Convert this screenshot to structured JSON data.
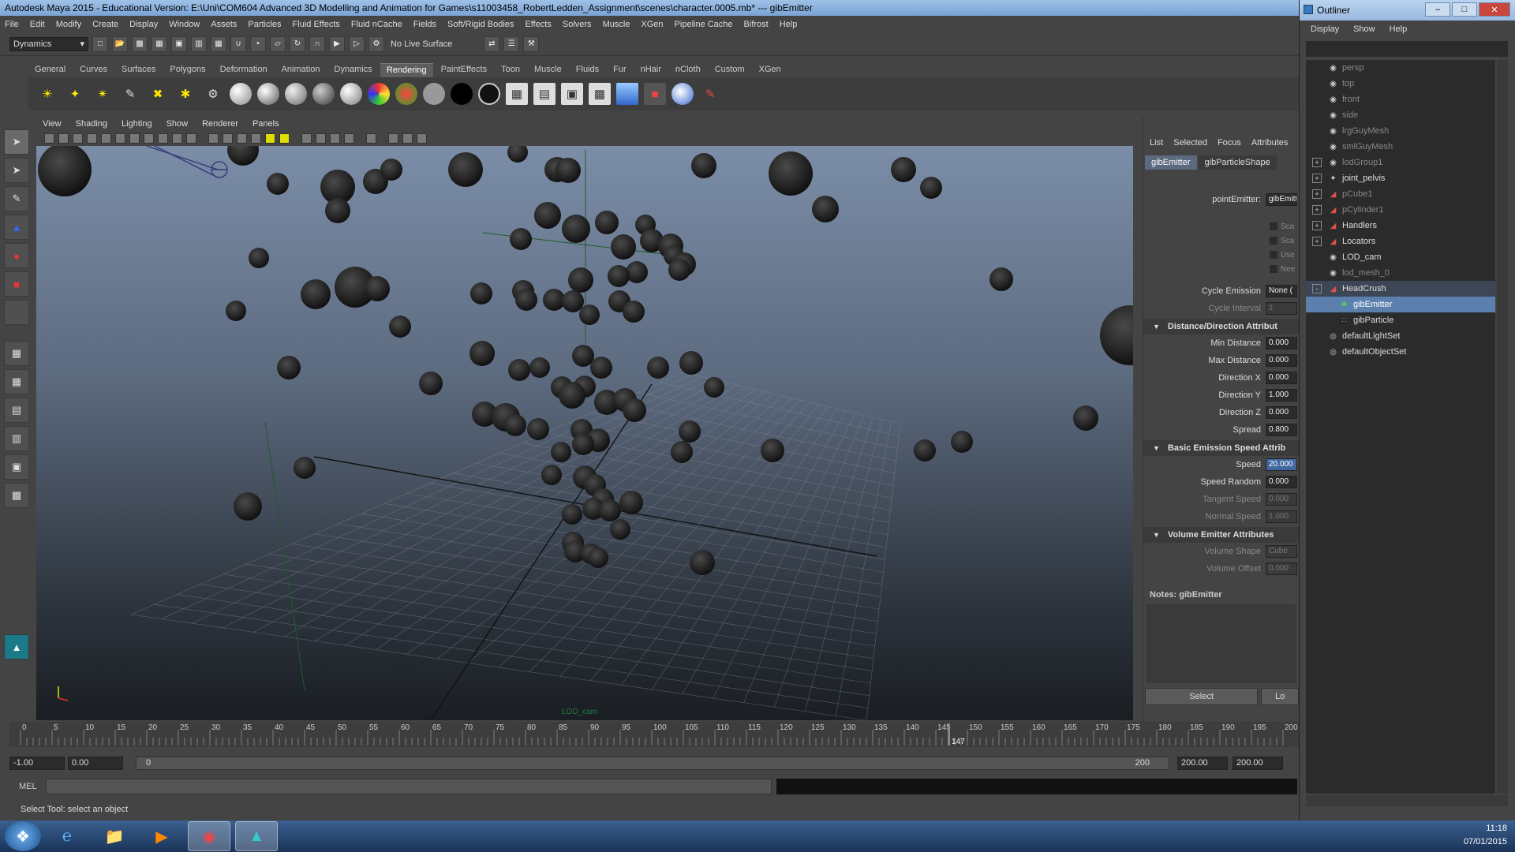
{
  "window": {
    "title": "Autodesk Maya 2015 - Educational Version: E:\\Uni\\COM604 Advanced 3D Modelling and Animation for Games\\s11003458_RobertLedden_Assignment\\scenes\\character.0005.mb*   ---   gibEmitter"
  },
  "menus": [
    "File",
    "Edit",
    "Modify",
    "Create",
    "Display",
    "Window",
    "Assets",
    "Particles",
    "Fluid Effects",
    "Fluid nCache",
    "Fields",
    "Soft/Rigid Bodies",
    "Effects",
    "Solvers",
    "Muscle",
    "XGen",
    "Pipeline Cache",
    "Bifrost",
    "Help"
  ],
  "status_line": {
    "menu_set": "Dynamics",
    "live_surface": "No Live Surface"
  },
  "shelf_tabs": [
    "General",
    "Curves",
    "Surfaces",
    "Polygons",
    "Deformation",
    "Animation",
    "Dynamics",
    "Rendering",
    "PaintEffects",
    "Toon",
    "Muscle",
    "Fluids",
    "Fur",
    "nHair",
    "nCloth",
    "Custom",
    "XGen"
  ],
  "active_shelf_tab": "Rendering",
  "viewport_menu": [
    "View",
    "Shading",
    "Lighting",
    "Show",
    "Renderer",
    "Panels"
  ],
  "viewport_camera_label": "LOD_cam",
  "attribute_editor": {
    "header_tabs": [
      "List",
      "Selected",
      "Focus",
      "Attributes"
    ],
    "node_tabs": [
      "gibEmitter",
      "gibParticleShape"
    ],
    "point_emitter_label": "pointEmitter:",
    "point_emitter_value": "gibEmitt",
    "checkbox_labels": [
      "Sca",
      "Sca",
      "Use",
      "Nee"
    ],
    "cycle_emission": {
      "label": "Cycle Emission",
      "value": "None ("
    },
    "cycle_interval": {
      "label": "Cycle Interval",
      "value": "1"
    },
    "sections": [
      {
        "title": "Distance/Direction Attribut",
        "fields": [
          {
            "label": "Min Distance",
            "value": "0.000"
          },
          {
            "label": "Max Distance",
            "value": "0.000"
          },
          {
            "label": "Direction X",
            "value": "0.000"
          },
          {
            "label": "Direction Y",
            "value": "1.000"
          },
          {
            "label": "Direction Z",
            "value": "0.000"
          },
          {
            "label": "Spread",
            "value": "0.800"
          }
        ]
      },
      {
        "title": "Basic Emission Speed Attrib",
        "fields": [
          {
            "label": "Speed",
            "value": "20.000"
          },
          {
            "label": "Speed Random",
            "value": "0.000"
          },
          {
            "label": "Tangent Speed",
            "value": "0.000"
          },
          {
            "label": "Normal Speed",
            "value": "1.000"
          }
        ]
      },
      {
        "title": "Volume Emitter Attributes",
        "fields": [
          {
            "label": "Volume Shape",
            "value": "Cube"
          },
          {
            "label": "Volume Offset",
            "value": "0.000"
          }
        ]
      }
    ],
    "notes_label": "Notes: gibEmitter",
    "select_button": "Select",
    "load_button": "Lo"
  },
  "timeline": {
    "ticks": [
      "0",
      "5",
      "10",
      "15",
      "20",
      "25",
      "30",
      "35",
      "40",
      "45",
      "50",
      "55",
      "60",
      "65",
      "70",
      "75",
      "80",
      "85",
      "90",
      "95",
      "100",
      "105",
      "110",
      "115",
      "120",
      "125",
      "130",
      "135",
      "140",
      "145",
      "150",
      "155",
      "160",
      "165",
      "170",
      "175",
      "180",
      "185",
      "190",
      "195",
      "200"
    ],
    "current_frame": "147",
    "current_frame_value": 147
  },
  "range": {
    "start_time": "-1.00",
    "playback_start": "0.00",
    "slider_start": "0",
    "slider_end": "200",
    "playback_end": "200.00",
    "end_time": "200.00"
  },
  "command_line": {
    "label": "MEL"
  },
  "help_line": "Select Tool: select an object",
  "outliner": {
    "title": "Outliner",
    "menu": [
      "Display",
      "Show",
      "Help"
    ],
    "items": [
      {
        "label": "persp",
        "dim": true,
        "icon": "camera-icon"
      },
      {
        "label": "top",
        "dim": true,
        "icon": "camera-icon"
      },
      {
        "label": "front",
        "dim": true,
        "icon": "camera-icon"
      },
      {
        "label": "side",
        "dim": true,
        "icon": "camera-icon"
      },
      {
        "label": "lrgGuyMesh",
        "dim": true,
        "icon": "mesh-icon"
      },
      {
        "label": "smlGuyMesh",
        "dim": true,
        "icon": "mesh-icon"
      },
      {
        "label": "lodGroup1",
        "dim": true,
        "icon": "group-icon",
        "expand": "+"
      },
      {
        "label": "joint_pelvis",
        "dim": false,
        "icon": "joint-icon",
        "expand": "+"
      },
      {
        "label": "pCube1",
        "dim": true,
        "icon": "transform-icon",
        "expand": "+"
      },
      {
        "label": "pCylinder1",
        "dim": true,
        "icon": "transform-icon",
        "expand": "+"
      },
      {
        "label": "Handlers",
        "dim": false,
        "icon": "transform-icon",
        "expand": "+"
      },
      {
        "label": "Locators",
        "dim": false,
        "icon": "transform-icon",
        "expand": "+"
      },
      {
        "label": "LOD_cam",
        "dim": false,
        "icon": "camera-icon"
      },
      {
        "label": "lod_mesh_0",
        "dim": true,
        "icon": "mesh-icon"
      },
      {
        "label": "HeadCrush",
        "dim": false,
        "icon": "transform-icon",
        "expand": "-",
        "highlight": true
      },
      {
        "label": "gibEmitter",
        "dim": false,
        "icon": "emitter-icon",
        "indent": true,
        "selected": true
      },
      {
        "label": "gibParticle",
        "dim": false,
        "icon": "particle-icon",
        "indent": true
      },
      {
        "label": "defaultLightSet",
        "dim": false,
        "icon": "set-icon"
      },
      {
        "label": "defaultObjectSet",
        "dim": false,
        "icon": "set-icon"
      }
    ]
  },
  "taskbar": {
    "time": "11:18",
    "date": "07/01/2015"
  },
  "colors": {
    "title_bar": "#8eb3df",
    "selection": "#5b80ad",
    "viewport_top": "#7b8da7",
    "viewport_bottom": "#1a1e23",
    "active_shelf_tab": "#5d5d5d"
  }
}
